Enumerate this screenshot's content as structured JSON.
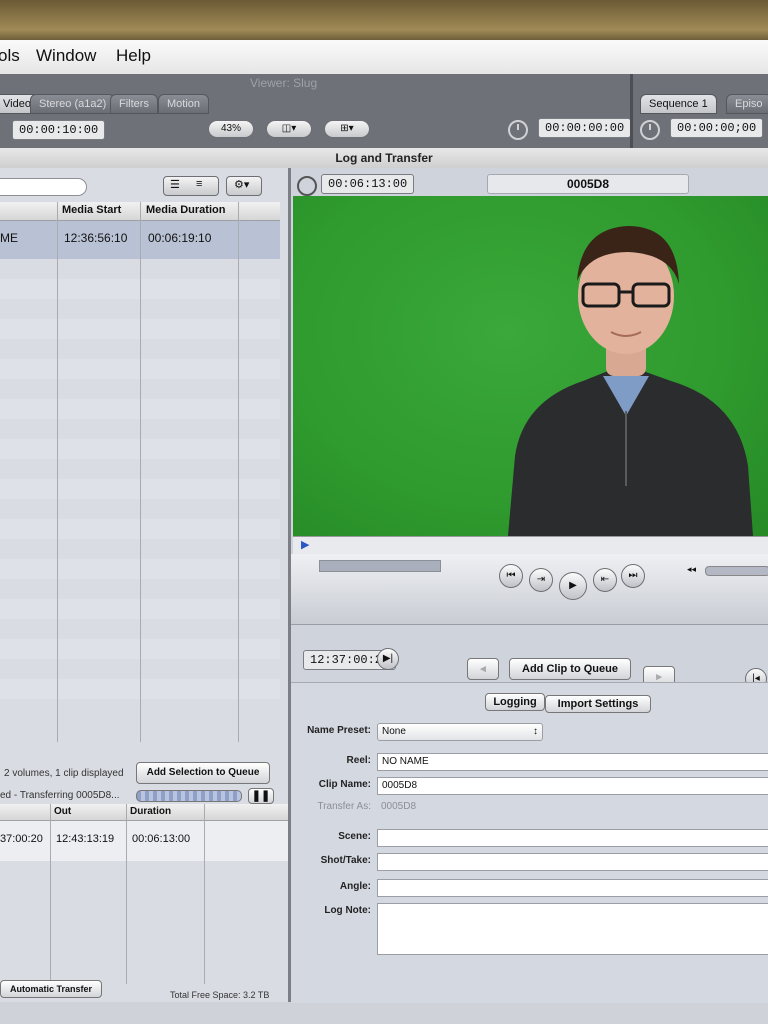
{
  "menu": {
    "items": [
      "ols",
      "Window",
      "Help"
    ]
  },
  "viewer": {
    "title": "Viewer: Slug",
    "tabs": [
      "Video",
      "Stereo (a1a2)",
      "Filters",
      "Motion"
    ],
    "timecode_duration": "00:00:10:00",
    "zoom": "43%",
    "timecode_current": "00:00:00:00",
    "sequence_tabs": [
      "Sequence 1",
      "Episo"
    ],
    "sequence_timecode": "00:00:00;00"
  },
  "log_transfer": {
    "title": "Log and Transfer",
    "browser": {
      "columns": [
        "Media Start",
        "Media Duration"
      ],
      "rows": [
        {
          "name": "ME",
          "media_start": "12:36:56:10",
          "media_duration": "00:06:19:10"
        }
      ],
      "summary": "2 volumes, 1 clip displayed",
      "add_selection_label": "Add Selection to Queue"
    },
    "queue": {
      "status": "ed - Transferring 0005D8...",
      "columns": [
        "Out",
        "Duration"
      ],
      "rows": [
        {
          "in": "37:00:20",
          "out": "12:43:13:19",
          "duration": "00:06:13:00"
        }
      ],
      "auto_transfer_label": "Automatic Transfer",
      "free_space": "Total Free Space: 3.2 TB"
    },
    "preview": {
      "duration_timecode": "00:06:13:00",
      "clip_title": "0005D8",
      "current_timecode": "12:37:00:20",
      "add_clip_label": "Add Clip to Queue"
    },
    "tabs": [
      "Logging",
      "Import Settings"
    ],
    "form": {
      "name_preset_label": "Name Preset:",
      "name_preset_value": "None",
      "reel_label": "Reel:",
      "reel_value": "NO NAME",
      "clip_name_label": "Clip Name:",
      "clip_name_value": "0005D8",
      "transfer_as_label": "Transfer As:",
      "transfer_as_value": "0005D8",
      "scene_label": "Scene:",
      "shot_label": "Shot/Take:",
      "angle_label": "Angle:",
      "log_note_label": "Log Note:"
    }
  },
  "colors": {
    "green_screen": "#2f9a2e",
    "selection": "#b9c1d4"
  }
}
